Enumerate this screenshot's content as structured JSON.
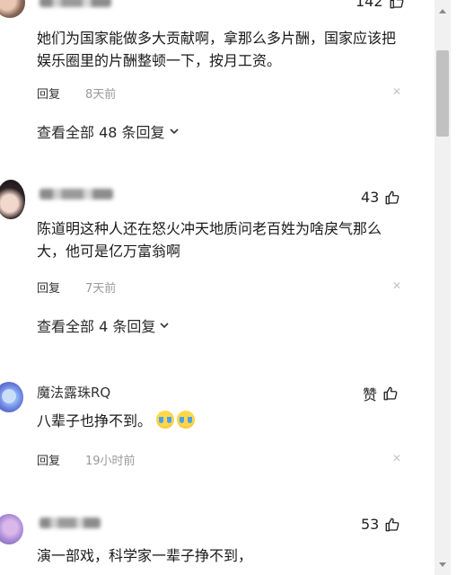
{
  "comments": [
    {
      "likes": "142",
      "text": "她们为国家能做多大贡献啊，拿那么多片酬，国家应该把娱乐圈里的片酬整顿一下，按月工资。",
      "reply_label": "回复",
      "time": "8天前",
      "view_all": "查看全部 48 条回复"
    },
    {
      "likes": "43",
      "text": "陈道明这种人还在怒火冲天地质问老百姓为啥戾气那么大，他可是亿万富翁啊",
      "reply_label": "回复",
      "time": "7天前",
      "view_all": "查看全部 4 条回复"
    },
    {
      "username": "魔法露珠RQ",
      "like_label": "赞",
      "text": "八辈子也挣不到。",
      "reply_label": "回复",
      "time": "19小时前"
    },
    {
      "likes": "53",
      "text": "演一部戏，科学家一辈子挣不到，"
    }
  ],
  "icons": {
    "like": "thumbs-up-icon",
    "close": "close-icon",
    "expand": "chevron-down-icon",
    "emoji": "laughing-tears-emoji"
  }
}
